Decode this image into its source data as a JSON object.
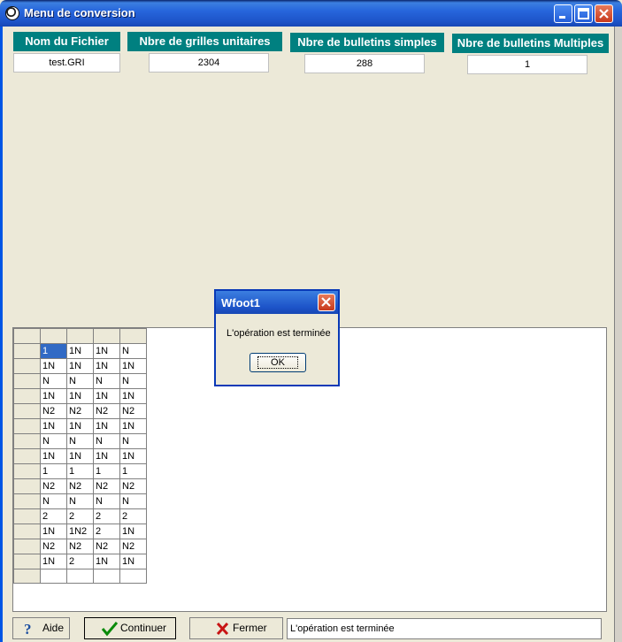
{
  "window": {
    "title": "Menu de conversion"
  },
  "summary": {
    "headers": [
      "Nom du Fichier",
      "Nbre de grilles unitaires",
      "Nbre de bulletins simples",
      "Nbre de bulletins Multiples"
    ],
    "values": [
      "test.GRI",
      "2304",
      "288",
      "1"
    ]
  },
  "grid": {
    "rows": [
      [
        "1",
        "1N",
        "1N",
        "N"
      ],
      [
        "1N",
        "1N",
        "1N",
        "1N"
      ],
      [
        "N",
        "N",
        "N",
        "N"
      ],
      [
        "1N",
        "1N",
        "1N",
        "1N"
      ],
      [
        "N2",
        "N2",
        "N2",
        "N2"
      ],
      [
        "1N",
        "1N",
        "1N",
        "1N"
      ],
      [
        "N",
        "N",
        "N",
        "N"
      ],
      [
        "1N",
        "1N",
        "1N",
        "1N"
      ],
      [
        "1",
        "1",
        "1",
        "1"
      ],
      [
        "N2",
        "N2",
        "N2",
        "N2"
      ],
      [
        "N",
        "N",
        "N",
        "N"
      ],
      [
        "2",
        "2",
        "2",
        "2"
      ],
      [
        "1N",
        "1N2",
        "2",
        "1N"
      ],
      [
        "N2",
        "N2",
        "N2",
        "N2"
      ],
      [
        "1N",
        "2",
        "1N",
        "1N"
      ],
      [
        "",
        "",
        "",
        ""
      ]
    ]
  },
  "dialog": {
    "title": "Wfoot1",
    "message": "L'opération est terminée",
    "ok_label": "OK"
  },
  "buttons": {
    "help": "Aide",
    "continue": "Continuer",
    "close": "Fermer"
  },
  "status": {
    "text": "L'opération est terminée"
  },
  "icons": {
    "help": "question-mark-icon",
    "continue": "green-check-icon",
    "close": "red-x-icon"
  },
  "colors": {
    "header_bg": "#008080",
    "titlebar": "#1d54c9",
    "selected_cell": "#316ac5"
  }
}
